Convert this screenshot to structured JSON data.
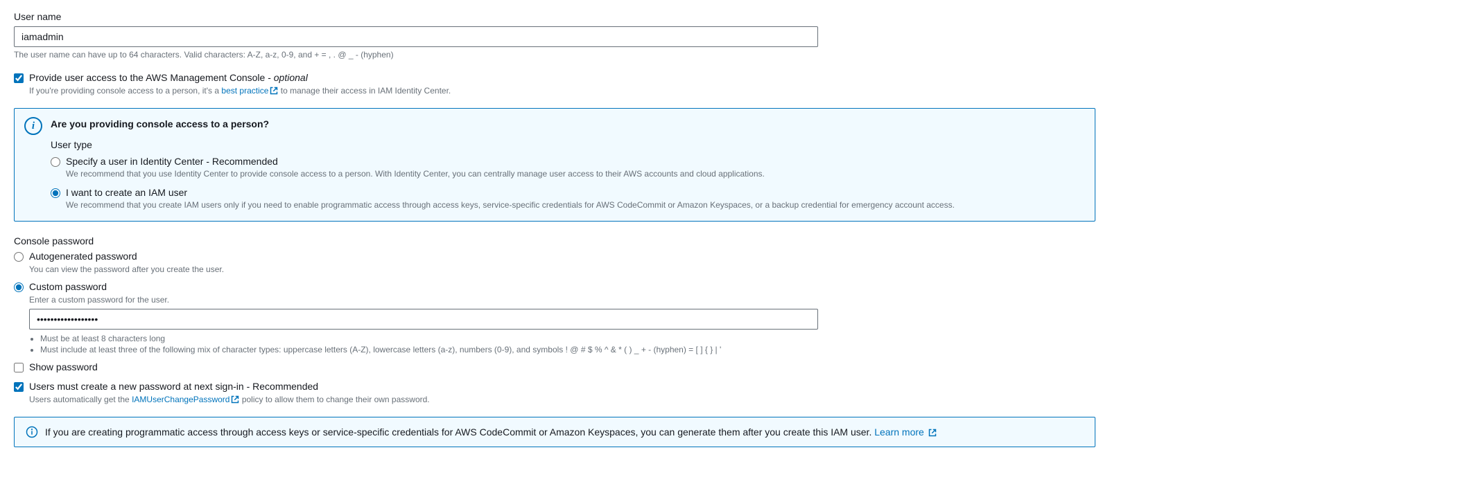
{
  "username": {
    "label": "User name",
    "value": "iamadmin",
    "hint": "The user name can have up to 64 characters. Valid characters: A-Z, a-z, 0-9, and + = , . @ _ - (hyphen)"
  },
  "consoleAccess": {
    "checkbox_label": "Provide user access to the AWS Management Console - ",
    "optional_text": "optional",
    "hint_prefix": "If you're providing console access to a person, it's a ",
    "best_practice_link": "best practice",
    "hint_suffix": " to manage their access in IAM Identity Center.",
    "checked": true
  },
  "infoBox": {
    "title": "Are you providing console access to a person?",
    "subtitle": "User type",
    "options": [
      {
        "label": "Specify a user in Identity Center - Recommended",
        "desc": "We recommend that you use Identity Center to provide console access to a person. With Identity Center, you can centrally manage user access to their AWS accounts and cloud applications.",
        "selected": false
      },
      {
        "label": "I want to create an IAM user",
        "desc": "We recommend that you create IAM users only if you need to enable programmatic access through access keys, service-specific credentials for AWS CodeCommit or Amazon Keyspaces, or a backup credential for emergency account access.",
        "selected": true
      }
    ]
  },
  "consolePassword": {
    "heading": "Console password",
    "options": {
      "auto": {
        "label": "Autogenerated password",
        "desc": "You can view the password after you create the user.",
        "selected": false
      },
      "custom": {
        "label": "Custom password",
        "desc": "Enter a custom password for the user.",
        "selected": true,
        "value": "••••••••••••••••••"
      }
    },
    "requirements": [
      "Must be at least 8 characters long",
      "Must include at least three of the following mix of character types: uppercase letters (A-Z), lowercase letters (a-z), numbers (0-9), and symbols ! @ # $ % ^ & * ( ) _ + - (hyphen) = [ ] { } | '"
    ],
    "showPassword": {
      "label": "Show password",
      "checked": false
    }
  },
  "mustChange": {
    "label": "Users must create a new password at next sign-in - Recommended",
    "checked": true,
    "hint_prefix": "Users automatically get the ",
    "policy_link": "IAMUserChangePassword",
    "hint_suffix": " policy to allow them to change their own password."
  },
  "bottomInfo": {
    "text": "If you are creating programmatic access through access keys or service-specific credentials for AWS CodeCommit or Amazon Keyspaces, you can generate them after you create this IAM user. ",
    "link": "Learn more"
  }
}
